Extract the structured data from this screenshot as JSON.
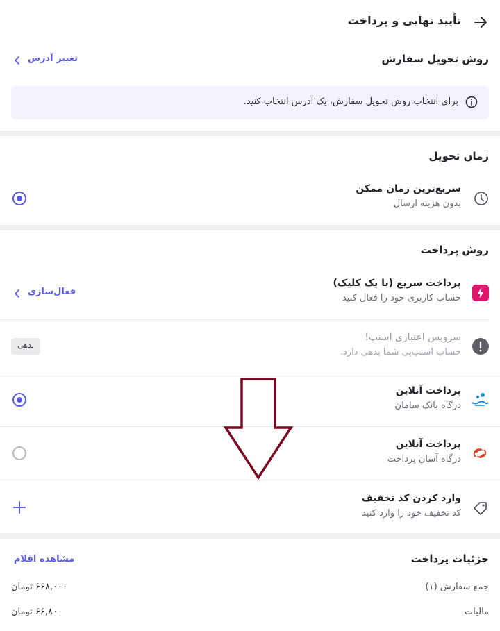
{
  "header": {
    "title": "تأیید نهایی و پرداخت"
  },
  "delivery": {
    "title": "روش تحویل سفارش",
    "change_address": "تغییر آدرس",
    "info": "برای انتخاب روش تحویل سفارش، یک آدرس انتخاب کنید."
  },
  "delivery_time": {
    "title": "زمان تحویل",
    "option_title": "سریع‌ترین زمان ممکن",
    "option_sub": "بدون هزینه ارسال"
  },
  "payment": {
    "title": "روش پرداخت",
    "quick": {
      "title": "پرداخت سریع (با یک کلیک)",
      "sub": "حساب کاربری خود را فعال کنید",
      "action": "فعال‌سازی"
    },
    "credit": {
      "title": "سرویس اعتباری اسنپ!",
      "sub": "حساب اسنپ‌پی شما بدهی دارد.",
      "badge": "بدهی"
    },
    "online1": {
      "title": "پرداخت آنلاین",
      "sub": "درگاه بانک سامان"
    },
    "online2": {
      "title": "پرداخت آنلاین",
      "sub": "درگاه آسان پرداخت"
    }
  },
  "discount": {
    "title": "وارد کردن کد تخفیف",
    "sub": "کد تخفیف خود را وارد کنید"
  },
  "details": {
    "title": "جزئیات پرداخت",
    "view_items": "مشاهده اقلام",
    "rows": [
      {
        "label": "جمع سفارش (۱)",
        "value": "۶۶۸,۰۰۰ تومان"
      },
      {
        "label": "مالیات",
        "value": "۶۶,۸۰۰ تومان"
      }
    ]
  },
  "colors": {
    "accent": "#5a5ce6",
    "arrow": "#7a0a22",
    "quick_icon": "#e0156e"
  },
  "icons": [
    "arrow-right-icon",
    "chevron-left-icon",
    "info-icon",
    "clock-icon",
    "lightning-icon",
    "alert-icon",
    "saman-bank-icon",
    "asan-pardakht-icon",
    "tag-icon",
    "plus-icon",
    "down-arrow-annotation"
  ]
}
